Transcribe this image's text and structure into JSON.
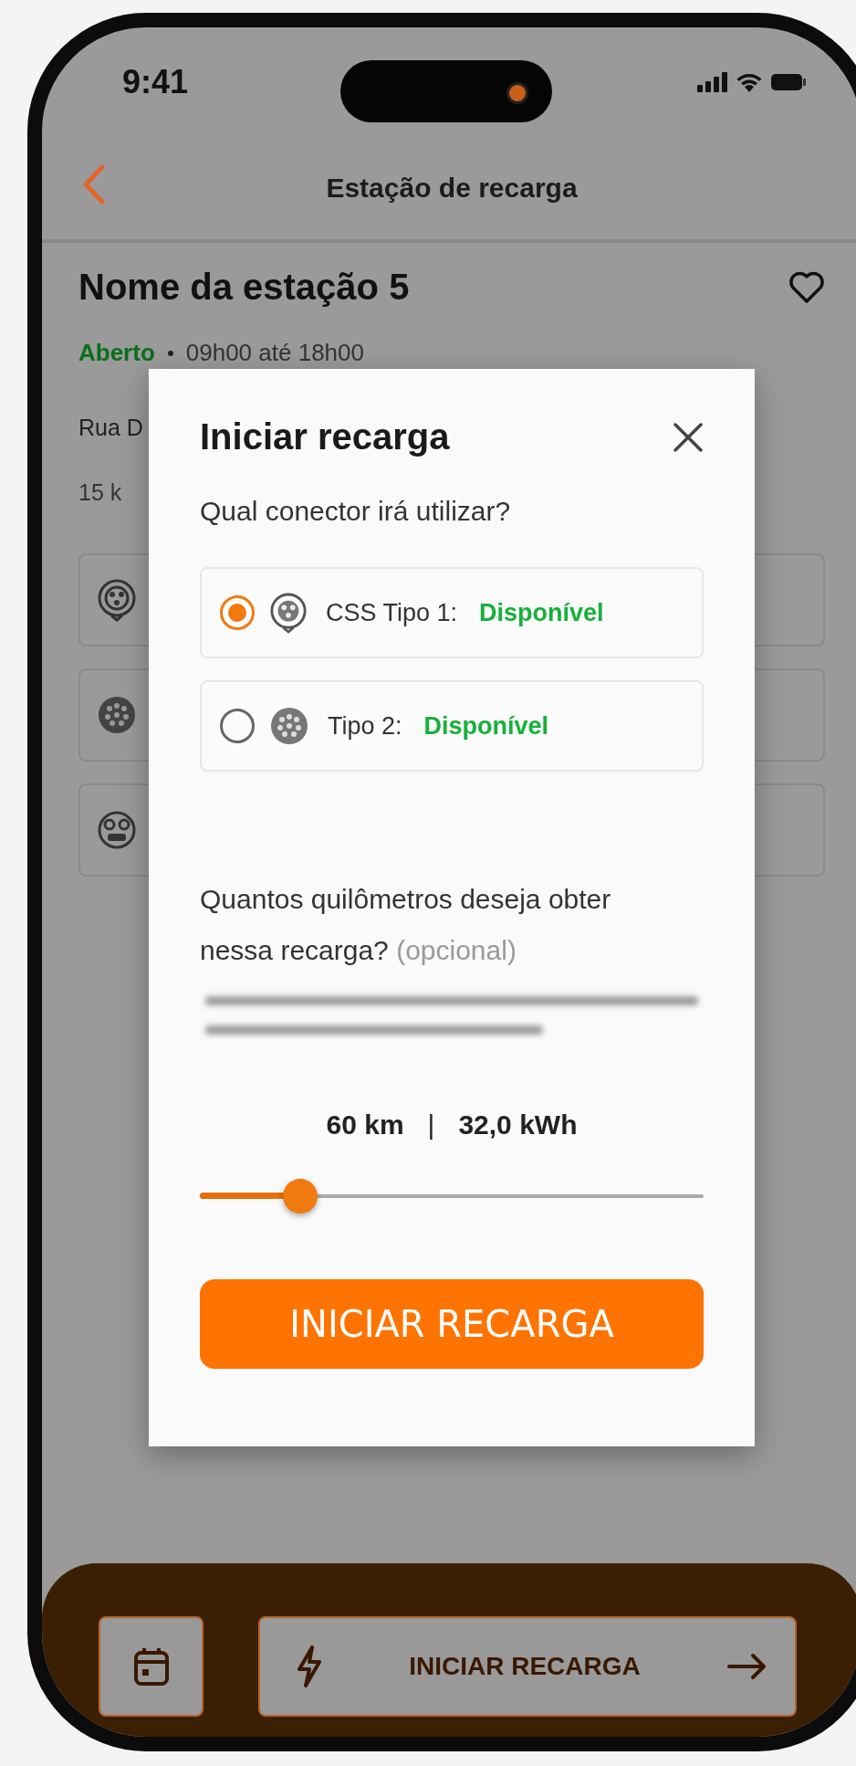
{
  "status_bar": {
    "time": "9:41"
  },
  "header": {
    "title": "Estação de recarga"
  },
  "station": {
    "name": "Nome da estação 5",
    "status": "Aberto",
    "hours": "09h00 até 18h00",
    "address": "Rua D",
    "distance": "15 k"
  },
  "connectors": [
    {
      "kind": "ccs1"
    },
    {
      "kind": "type2"
    },
    {
      "kind": "chademo"
    }
  ],
  "modal": {
    "title": "Iniciar recarga",
    "question": "Qual conector irá utilizar?",
    "options": [
      {
        "kind": "ccs1",
        "label": "CSS Tipo 1:",
        "status": "Disponível",
        "selected": true
      },
      {
        "kind": "type2",
        "label": "Tipo 2:",
        "status": "Disponível",
        "selected": false
      }
    ],
    "distance_question": "Quantos quilômetros deseja obter nessa recarga?",
    "optional_note": "(opcional)",
    "distance": "60 km",
    "separator": "|",
    "energy": "32,0 kWh",
    "slider": {
      "level": 0.2
    },
    "button": "INICIAR RECARGA"
  },
  "bottom_bar": {
    "button": "INICIAR RECARGA"
  }
}
